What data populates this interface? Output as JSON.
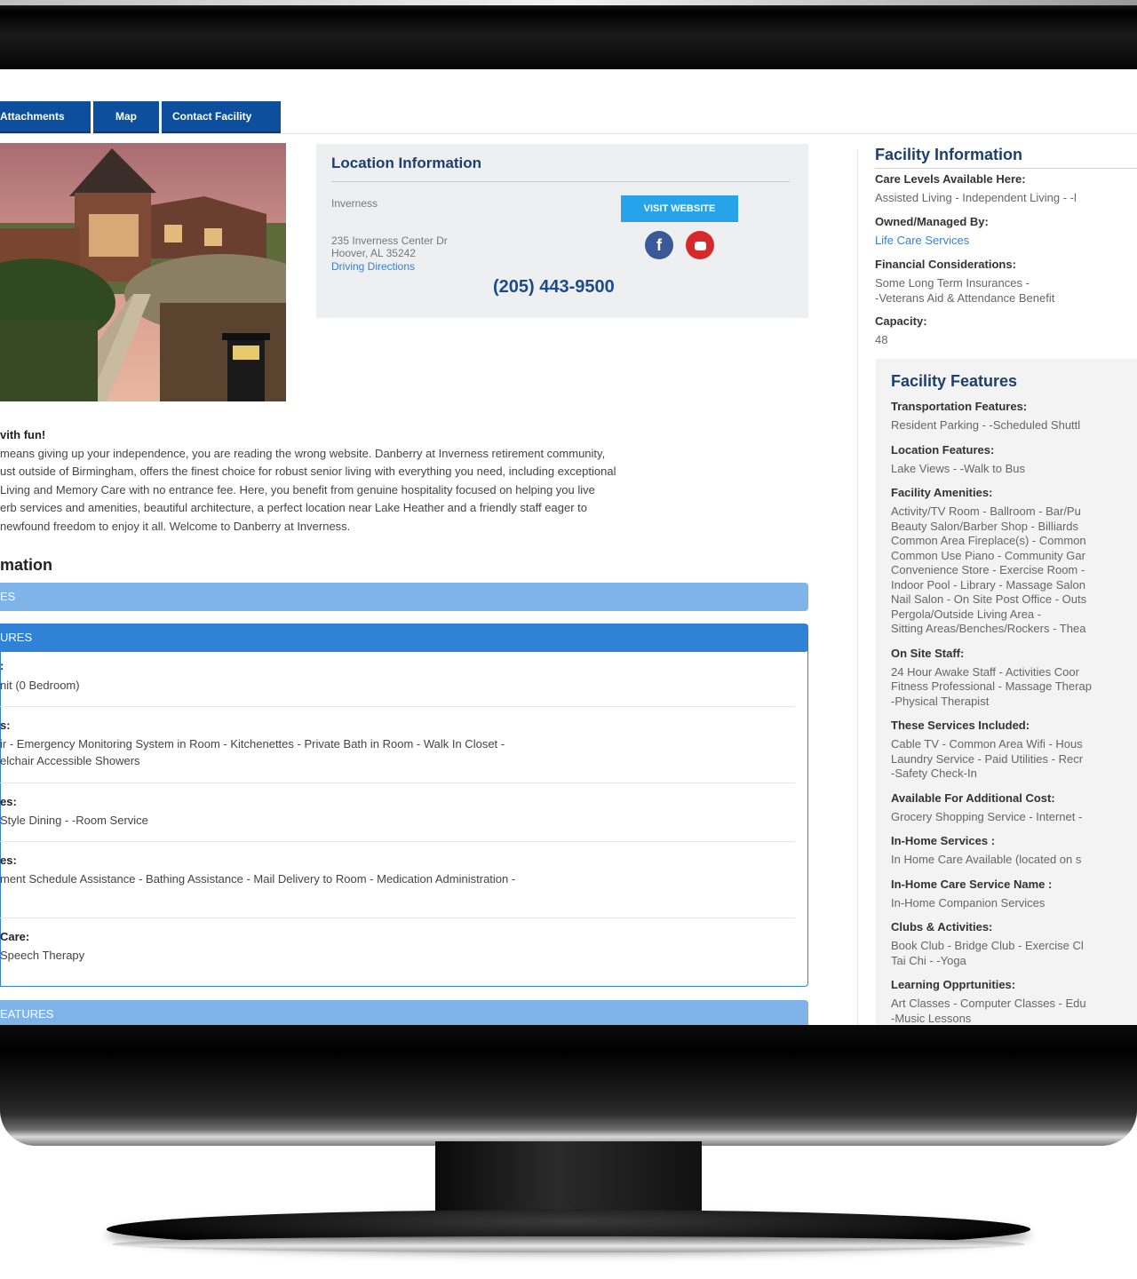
{
  "tabs": [
    "Attachments",
    "Map",
    "Contact Facility"
  ],
  "location": {
    "heading": "Location Information",
    "area": "Inverness",
    "street": "235 Inverness Center Dr",
    "city": "Hoover, AL 35242",
    "directions": "Driving Directions",
    "website_button": "VISIT WEBSITE",
    "phone": "(205) 443-9500"
  },
  "intro": {
    "heading": "vith fun!",
    "lines": [
      "means giving up your independence, you are reading the wrong website.  Danberry at Inverness retirement community,",
      "ust outside of Birmingham, offers the finest choice for robust senior living with everything you need, including exceptional",
      "Living and Memory Care with no entrance fee.  Here, you benefit from genuine hospitality focused on helping you live",
      "erb services and amenities, beautiful architecture, a perfect location near Lake Heather and a friendly staff eager to",
      "newfound freedom to enjoy it all.  Welcome to Danberry at Inverness."
    ]
  },
  "info_section": {
    "title": "mation",
    "bar1": "ES",
    "bar2": "URES",
    "bar3": "EATURES",
    "rows": [
      {
        "label": ":",
        "value": "nit (0 Bedroom)"
      },
      {
        "label": "s:",
        "value": "ir - Emergency Monitoring System in Room - Kitchenettes - Private Bath in Room - Walk In Closet -",
        "value2": "elchair Accessible Showers"
      },
      {
        "label": "es:",
        "value": " Style Dining - -Room Service"
      },
      {
        "label": "es:",
        "value": "ment Schedule Assistance - Bathing Assistance - Mail Delivery to Room - Medication Administration -"
      },
      {
        "label": "Care:",
        "value": "Speech Therapy"
      }
    ]
  },
  "facility_info": {
    "heading": "Facility Information",
    "care_levels_label": "Care Levels Available Here:",
    "care_levels": "Assisted Living - Independent Living - -l",
    "owned_label": "Owned/Managed By:",
    "owned": "Life Care Services",
    "financial_label": "Financial Considerations:",
    "financial_1": "Some Long Term Insurances -",
    "financial_2": "-Veterans Aid & Attendance Benefit",
    "capacity_label": "Capacity:",
    "capacity": "48"
  },
  "facility_features": {
    "heading": "Facility Features",
    "items": [
      {
        "label": "Transportation Features:",
        "lines": [
          "Resident Parking - -Scheduled Shuttl"
        ]
      },
      {
        "label": "Location Features:",
        "lines": [
          "Lake Views - -Walk to Bus"
        ]
      },
      {
        "label": "Facility Amenities:",
        "lines": [
          "Activity/TV Room - Ballroom - Bar/Pu",
          "Beauty Salon/Barber Shop - Billiards",
          "Common Area Fireplace(s) - Common",
          "Common Use Piano - Community Gar",
          "Convenience Store - Exercise Room -",
          "Indoor Pool - Library - Massage Salon",
          "Nail Salon - On Site Post Office - Outs",
          "Pergola/Outside Living Area -",
          "Sitting Areas/Benches/Rockers - Thea"
        ]
      },
      {
        "label": "On Site Staff:",
        "lines": [
          "24 Hour Awake Staff - Activities Coor",
          "Fitness Professional - Massage Therap",
          "-Physical Therapist"
        ]
      },
      {
        "label": "These Services Included:",
        "lines": [
          "Cable TV - Common Area Wifi - Hous",
          "Laundry Service - Paid Utilities - Recr",
          "-Safety Check-In"
        ]
      },
      {
        "label": "Available For Additional Cost:",
        "lines": [
          "Grocery Shopping Service - Internet -"
        ]
      },
      {
        "label": "In-Home Services :",
        "lines": [
          "In Home Care Available (located on s"
        ]
      },
      {
        "label": "In-Home Care Service Name :",
        "lines": [
          "In-Home Companion Services"
        ]
      },
      {
        "label": "Clubs & Activities:",
        "lines": [
          "Book Club - Bridge Club - Exercise Cl",
          "Tai Chi - -Yoga"
        ]
      },
      {
        "label": "Learning Opprtunities:",
        "lines": [
          "Art Classes - Computer Classes - Edu",
          "-Music Lessons"
        ]
      }
    ]
  }
}
